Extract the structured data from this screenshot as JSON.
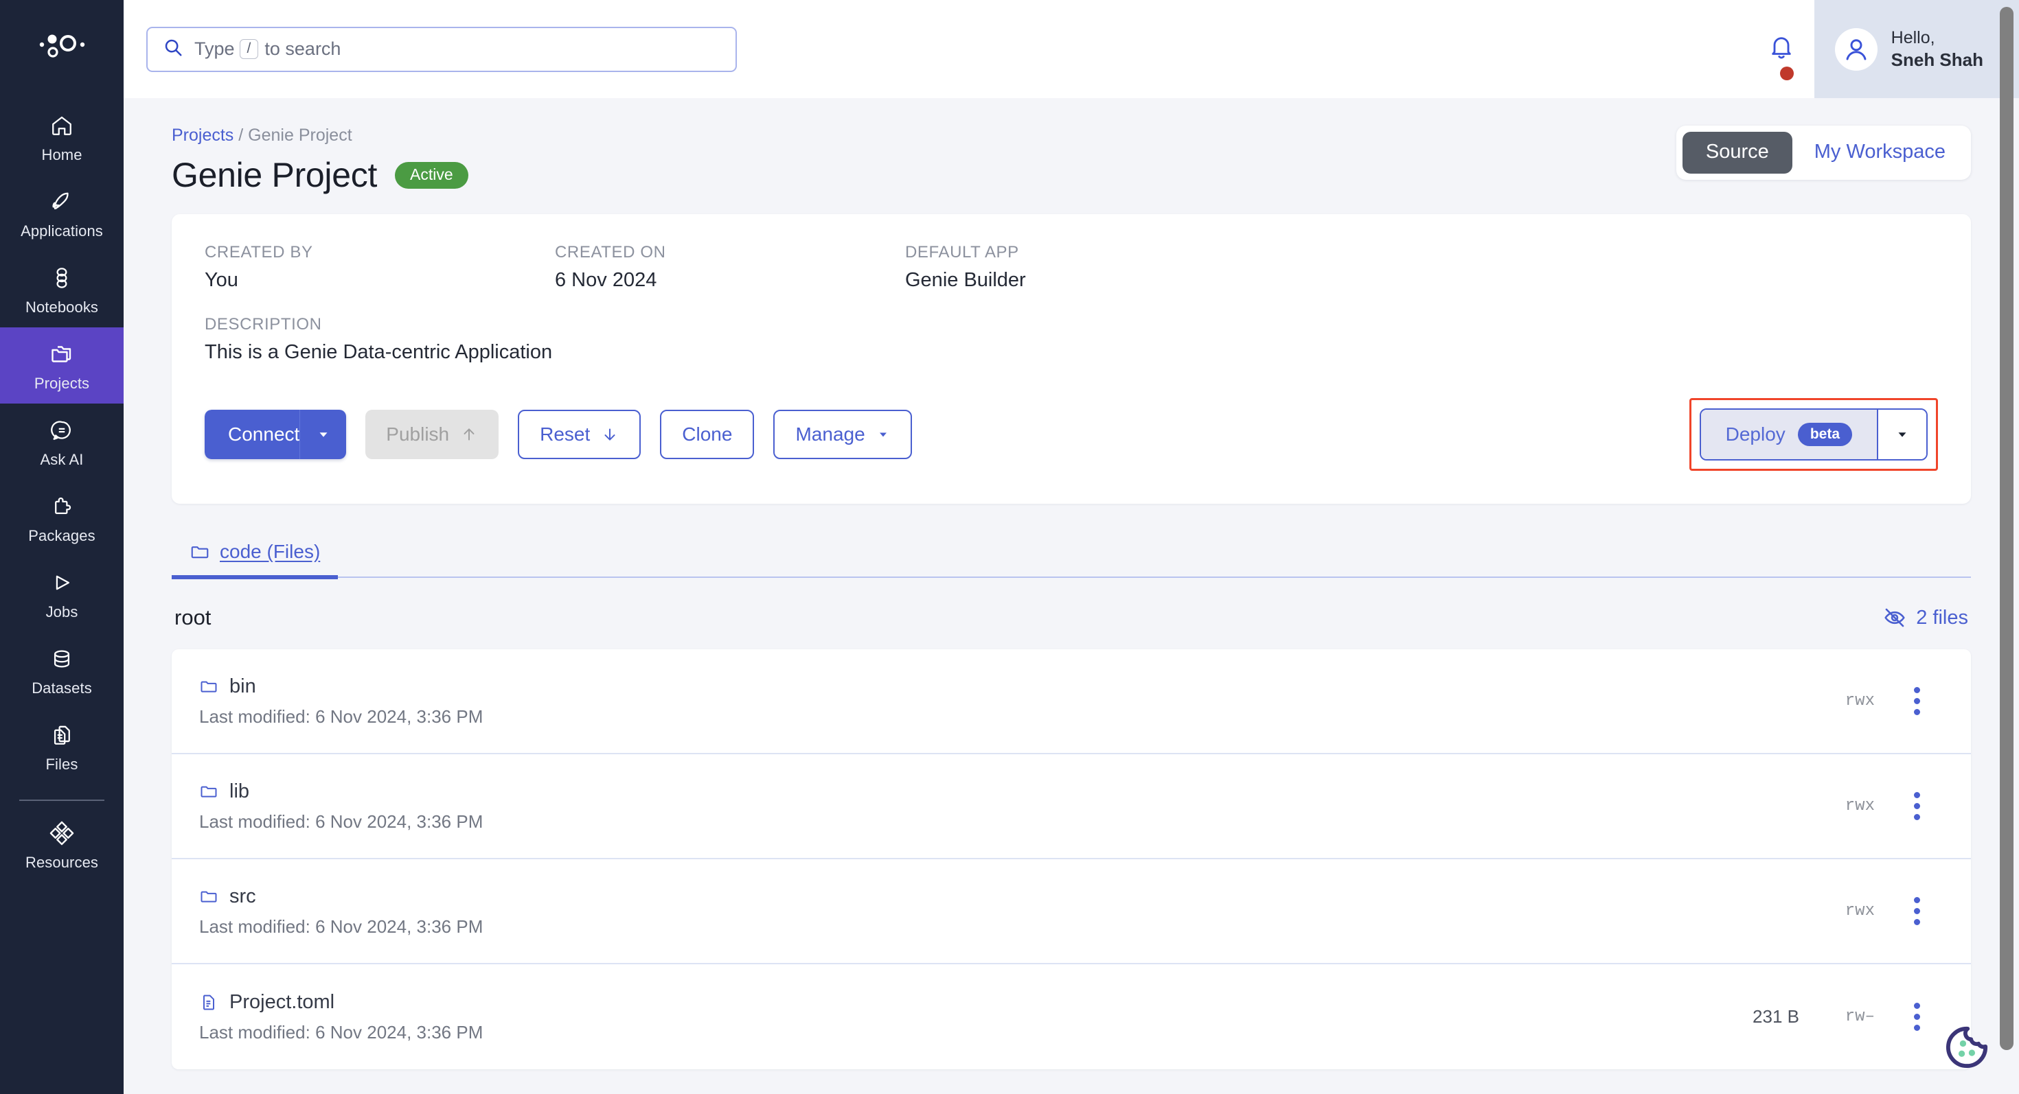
{
  "brand": {
    "logo_icon": "bubbles-logo-icon"
  },
  "sidebar": {
    "items": [
      {
        "label": "Home",
        "icon": "home-icon",
        "active": false
      },
      {
        "label": "Applications",
        "icon": "rocket-icon",
        "active": false
      },
      {
        "label": "Notebooks",
        "icon": "notebook-stack-icon",
        "active": false
      },
      {
        "label": "Projects",
        "icon": "folders-icon",
        "active": true
      },
      {
        "label": "Ask AI",
        "icon": "chat-bubble-icon",
        "active": false
      },
      {
        "label": "Packages",
        "icon": "puzzle-piece-icon",
        "active": false
      },
      {
        "label": "Jobs",
        "icon": "play-triangle-icon",
        "active": false
      },
      {
        "label": "Datasets",
        "icon": "database-icon",
        "active": false
      },
      {
        "label": "Files",
        "icon": "documents-icon",
        "active": false
      },
      {
        "label": "Resources",
        "icon": "diamonds-icon",
        "active": false
      }
    ]
  },
  "topbar": {
    "search": {
      "placeholder_before": "Type",
      "key_hint": "/",
      "placeholder_after": "to search",
      "value": "",
      "icon": "search-icon"
    },
    "notifications": {
      "icon": "bell-icon",
      "has_unread": true,
      "dot_color": "#c0392b"
    },
    "user": {
      "greeting": "Hello,",
      "name": "Sneh Shah",
      "avatar_icon": "user-avatar-icon"
    }
  },
  "breadcrumb": {
    "parent": "Projects",
    "separator": "/",
    "current": "Genie Project"
  },
  "header": {
    "title": "Genie Project",
    "status_badge": "Active",
    "status_color": "#4b9b43",
    "segments": [
      {
        "label": "Source",
        "selected": true
      },
      {
        "label": "My Workspace",
        "selected": false
      }
    ]
  },
  "details": {
    "created_by_label": "CREATED BY",
    "created_by_value": "You",
    "created_on_label": "CREATED ON",
    "created_on_value": "6 Nov 2024",
    "default_app_label": "DEFAULT APP",
    "default_app_value": "Genie Builder",
    "description_label": "DESCRIPTION",
    "description_value": "This is a Genie Data-centric Application"
  },
  "actions": {
    "connect": "Connect",
    "publish": "Publish",
    "reset": "Reset",
    "clone": "Clone",
    "manage": "Manage",
    "deploy": "Deploy",
    "deploy_badge": "beta",
    "highlight_color": "#f0452a",
    "primary_color": "#4a5fd0"
  },
  "tabs": [
    {
      "label": "code (Files)",
      "icon": "folder-icon",
      "active": true
    }
  ],
  "file_browser": {
    "root_label": "root",
    "hidden_files_label": "2 files",
    "hidden_files_icon": "eye-off-icon",
    "rows": [
      {
        "name": "bin",
        "type": "folder",
        "icon": "folder-icon",
        "modified": "Last modified: 6 Nov 2024, 3:36 PM",
        "size": "",
        "perm": "rwx"
      },
      {
        "name": "lib",
        "type": "folder",
        "icon": "folder-icon",
        "modified": "Last modified: 6 Nov 2024, 3:36 PM",
        "size": "",
        "perm": "rwx"
      },
      {
        "name": "src",
        "type": "folder",
        "icon": "folder-icon",
        "modified": "Last modified: 6 Nov 2024, 3:36 PM",
        "size": "",
        "perm": "rwx"
      },
      {
        "name": "Project.toml",
        "type": "file",
        "icon": "file-icon",
        "modified": "Last modified: 6 Nov 2024, 3:36 PM",
        "size": "231 B",
        "perm": "rw–"
      }
    ]
  },
  "cookie_widget": {
    "icon": "cookie-icon"
  }
}
